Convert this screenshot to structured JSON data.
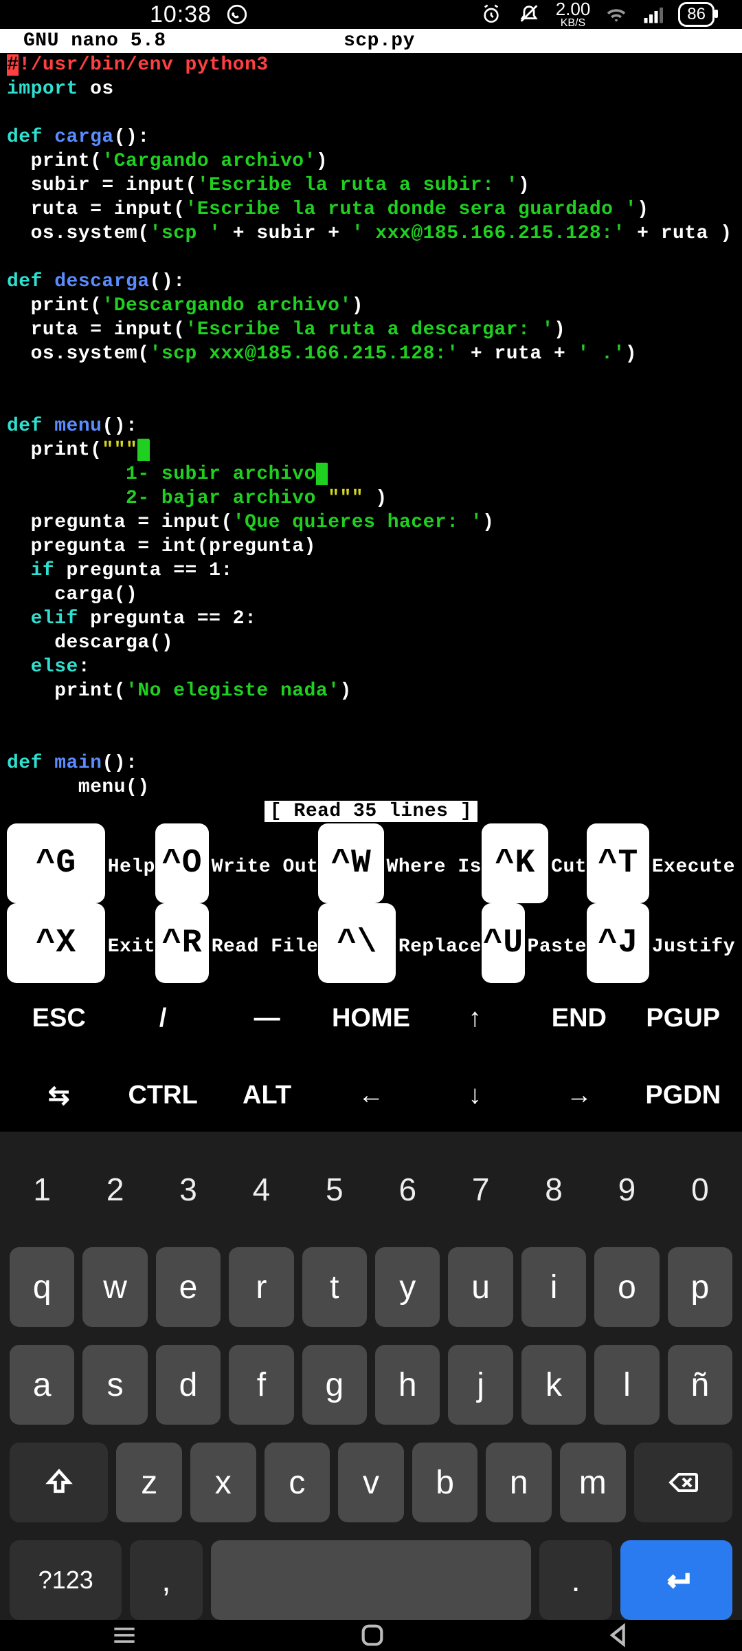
{
  "status": {
    "time": "10:38",
    "net_speed_value": "2.00",
    "net_speed_unit": "KB/S",
    "battery": "86"
  },
  "editor": {
    "app": "GNU nano 5.8",
    "filename": "scp.py",
    "status_message": "[ Read 35 lines ]",
    "code": {
      "shebang_mark": "#",
      "shebang_rest": "!/usr/bin/env python3",
      "import_kw": "import",
      "import_mod": " os",
      "def1_kw": "def",
      "def1_name": " carga",
      "def1_paren": "():",
      "l1a": "  print(",
      "l1a_str": "'Cargando archivo'",
      "l1a_end": ")",
      "l1b": "  subir = input(",
      "l1b_str": "'Escribe la ruta a subir: '",
      "l1b_end": ")",
      "l1c": "  ruta = input(",
      "l1c_str": "'Escribe la ruta donde sera guardado '",
      "l1c_end": ")",
      "l1d": "  os.system(",
      "l1d_s1": "'scp '",
      "l1d_m1": " + subir + ",
      "l1d_s2": "' xxx@185.166.215.128:'",
      "l1d_m2": " + ruta )",
      "def2_kw": "def",
      "def2_name": " descarga",
      "def2_paren": "():",
      "l2a": "  print(",
      "l2a_str": "'Descargando archivo'",
      "l2a_end": ")",
      "l2b": "  ruta = input(",
      "l2b_str": "'Escribe la ruta a descargar: '",
      "l2b_end": ")",
      "l2c": "  os.system(",
      "l2c_s1": "'scp xxx@185.166.215.128:'",
      "l2c_m1": " + ruta + ",
      "l2c_s2": "' .'",
      "l2c_end": ")",
      "def3_kw": "def",
      "def3_name": " menu",
      "def3_paren": "():",
      "l3a": "  print(",
      "l3a_q": "\"\"\"",
      "l3b": "          1- subir archivo",
      "l3c": "          2- bajar archivo ",
      "l3c_q": "\"\"\"",
      "l3c_end": " )",
      "l3d": "  pregunta = input(",
      "l3d_str": "'Que quieres hacer: '",
      "l3d_end": ")",
      "l3e": "  pregunta = int(pregunta)",
      "l3f_kw": "  if",
      "l3f_rest": " pregunta == 1:",
      "l3g": "    carga()",
      "l3h_kw": "  elif",
      "l3h_rest": " pregunta == 2:",
      "l3i": "    descarga()",
      "l3j_kw": "  else",
      "l3j_rest": ":",
      "l3k": "    print(",
      "l3k_str": "'No elegiste nada'",
      "l3k_end": ")",
      "def4_kw": "def",
      "def4_name": " main",
      "def4_paren": "():",
      "l4a": "      menu()"
    },
    "shortcuts": [
      {
        "key": "^G",
        "label": "Help"
      },
      {
        "key": "^O",
        "label": "Write Out"
      },
      {
        "key": "^W",
        "label": "Where Is"
      },
      {
        "key": "^K",
        "label": "Cut"
      },
      {
        "key": "^T",
        "label": "Execute"
      },
      {
        "key": "^X",
        "label": "Exit"
      },
      {
        "key": "^R",
        "label": "Read File"
      },
      {
        "key": "^\\",
        "label": "Replace"
      },
      {
        "key": "^U",
        "label": "Paste"
      },
      {
        "key": "^J",
        "label": "Justify"
      }
    ]
  },
  "extra_keys": {
    "row1": [
      "ESC",
      "/",
      "—",
      "HOME",
      "↑",
      "END",
      "PGUP"
    ],
    "row2": [
      "⇆",
      "CTRL",
      "ALT",
      "←",
      "↓",
      "→",
      "PGDN"
    ]
  },
  "keyboard": {
    "numbers": [
      "1",
      "2",
      "3",
      "4",
      "5",
      "6",
      "7",
      "8",
      "9",
      "0"
    ],
    "row1": [
      "q",
      "w",
      "e",
      "r",
      "t",
      "y",
      "u",
      "i",
      "o",
      "p"
    ],
    "row2": [
      "a",
      "s",
      "d",
      "f",
      "g",
      "h",
      "j",
      "k",
      "l",
      "ñ"
    ],
    "row3": [
      "z",
      "x",
      "c",
      "v",
      "b",
      "n",
      "m"
    ],
    "sym": "?123",
    "comma": ",",
    "dot": "."
  }
}
